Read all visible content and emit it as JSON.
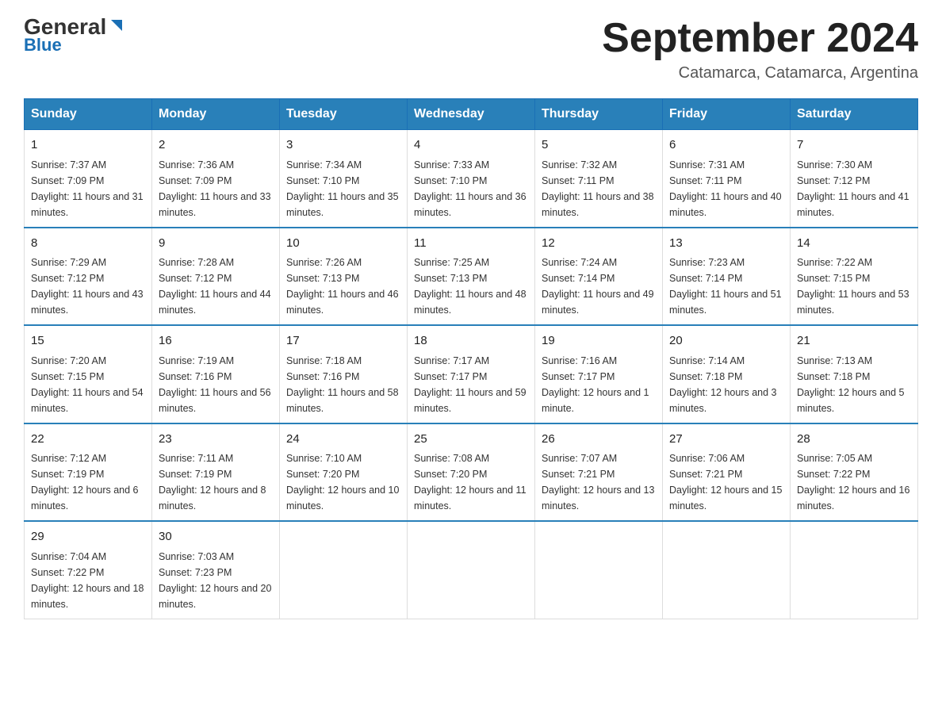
{
  "header": {
    "logo_general": "General",
    "logo_blue": "Blue",
    "month_title": "September 2024",
    "subtitle": "Catamarca, Catamarca, Argentina"
  },
  "weekdays": [
    "Sunday",
    "Monday",
    "Tuesday",
    "Wednesday",
    "Thursday",
    "Friday",
    "Saturday"
  ],
  "weeks": [
    [
      {
        "day": "1",
        "sunrise": "7:37 AM",
        "sunset": "7:09 PM",
        "daylight": "11 hours and 31 minutes."
      },
      {
        "day": "2",
        "sunrise": "7:36 AM",
        "sunset": "7:09 PM",
        "daylight": "11 hours and 33 minutes."
      },
      {
        "day": "3",
        "sunrise": "7:34 AM",
        "sunset": "7:10 PM",
        "daylight": "11 hours and 35 minutes."
      },
      {
        "day": "4",
        "sunrise": "7:33 AM",
        "sunset": "7:10 PM",
        "daylight": "11 hours and 36 minutes."
      },
      {
        "day": "5",
        "sunrise": "7:32 AM",
        "sunset": "7:11 PM",
        "daylight": "11 hours and 38 minutes."
      },
      {
        "day": "6",
        "sunrise": "7:31 AM",
        "sunset": "7:11 PM",
        "daylight": "11 hours and 40 minutes."
      },
      {
        "day": "7",
        "sunrise": "7:30 AM",
        "sunset": "7:12 PM",
        "daylight": "11 hours and 41 minutes."
      }
    ],
    [
      {
        "day": "8",
        "sunrise": "7:29 AM",
        "sunset": "7:12 PM",
        "daylight": "11 hours and 43 minutes."
      },
      {
        "day": "9",
        "sunrise": "7:28 AM",
        "sunset": "7:12 PM",
        "daylight": "11 hours and 44 minutes."
      },
      {
        "day": "10",
        "sunrise": "7:26 AM",
        "sunset": "7:13 PM",
        "daylight": "11 hours and 46 minutes."
      },
      {
        "day": "11",
        "sunrise": "7:25 AM",
        "sunset": "7:13 PM",
        "daylight": "11 hours and 48 minutes."
      },
      {
        "day": "12",
        "sunrise": "7:24 AM",
        "sunset": "7:14 PM",
        "daylight": "11 hours and 49 minutes."
      },
      {
        "day": "13",
        "sunrise": "7:23 AM",
        "sunset": "7:14 PM",
        "daylight": "11 hours and 51 minutes."
      },
      {
        "day": "14",
        "sunrise": "7:22 AM",
        "sunset": "7:15 PM",
        "daylight": "11 hours and 53 minutes."
      }
    ],
    [
      {
        "day": "15",
        "sunrise": "7:20 AM",
        "sunset": "7:15 PM",
        "daylight": "11 hours and 54 minutes."
      },
      {
        "day": "16",
        "sunrise": "7:19 AM",
        "sunset": "7:16 PM",
        "daylight": "11 hours and 56 minutes."
      },
      {
        "day": "17",
        "sunrise": "7:18 AM",
        "sunset": "7:16 PM",
        "daylight": "11 hours and 58 minutes."
      },
      {
        "day": "18",
        "sunrise": "7:17 AM",
        "sunset": "7:17 PM",
        "daylight": "11 hours and 59 minutes."
      },
      {
        "day": "19",
        "sunrise": "7:16 AM",
        "sunset": "7:17 PM",
        "daylight": "12 hours and 1 minute."
      },
      {
        "day": "20",
        "sunrise": "7:14 AM",
        "sunset": "7:18 PM",
        "daylight": "12 hours and 3 minutes."
      },
      {
        "day": "21",
        "sunrise": "7:13 AM",
        "sunset": "7:18 PM",
        "daylight": "12 hours and 5 minutes."
      }
    ],
    [
      {
        "day": "22",
        "sunrise": "7:12 AM",
        "sunset": "7:19 PM",
        "daylight": "12 hours and 6 minutes."
      },
      {
        "day": "23",
        "sunrise": "7:11 AM",
        "sunset": "7:19 PM",
        "daylight": "12 hours and 8 minutes."
      },
      {
        "day": "24",
        "sunrise": "7:10 AM",
        "sunset": "7:20 PM",
        "daylight": "12 hours and 10 minutes."
      },
      {
        "day": "25",
        "sunrise": "7:08 AM",
        "sunset": "7:20 PM",
        "daylight": "12 hours and 11 minutes."
      },
      {
        "day": "26",
        "sunrise": "7:07 AM",
        "sunset": "7:21 PM",
        "daylight": "12 hours and 13 minutes."
      },
      {
        "day": "27",
        "sunrise": "7:06 AM",
        "sunset": "7:21 PM",
        "daylight": "12 hours and 15 minutes."
      },
      {
        "day": "28",
        "sunrise": "7:05 AM",
        "sunset": "7:22 PM",
        "daylight": "12 hours and 16 minutes."
      }
    ],
    [
      {
        "day": "29",
        "sunrise": "7:04 AM",
        "sunset": "7:22 PM",
        "daylight": "12 hours and 18 minutes."
      },
      {
        "day": "30",
        "sunrise": "7:03 AM",
        "sunset": "7:23 PM",
        "daylight": "12 hours and 20 minutes."
      },
      null,
      null,
      null,
      null,
      null
    ]
  ],
  "labels": {
    "sunrise": "Sunrise:",
    "sunset": "Sunset:",
    "daylight": "Daylight:"
  }
}
